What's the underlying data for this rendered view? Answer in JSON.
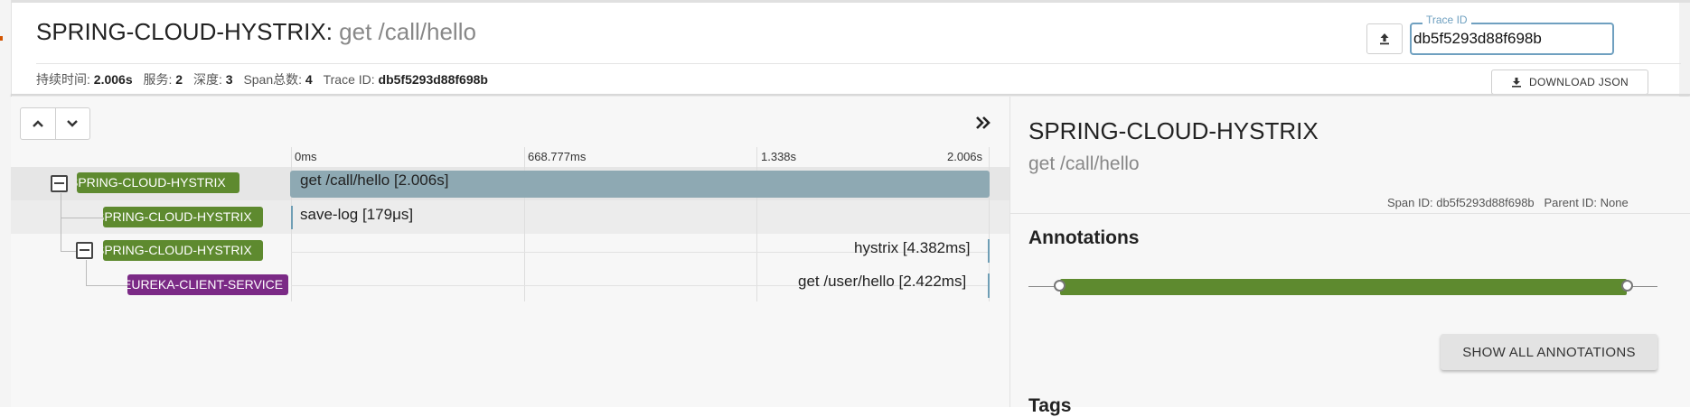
{
  "header": {
    "service": "SPRING-CLOUD-HYSTRIX",
    "separator": ":",
    "operation": "get /call/hello",
    "trace_id_label": "Trace ID",
    "trace_id_value": "db5f5293d88f698b",
    "download_label": "DOWNLOAD JSON",
    "meta": {
      "duration_label": "持续时间:",
      "duration_value": "2.006s",
      "services_label": "服务:",
      "services_value": "2",
      "depth_label": "深度:",
      "depth_value": "3",
      "span_total_label": "Span总数:",
      "span_total_value": "4",
      "trace_label": "Trace ID:",
      "trace_value": "db5f5293d88f698b"
    }
  },
  "timeline": {
    "ticks": [
      "0ms",
      "668.777ms",
      "1.338s",
      "2.006s"
    ],
    "rows": [
      {
        "service": "SPRING-CLOUD-HYSTRIX",
        "label": "get /call/hello [2.006s]",
        "color": "#5e8a2f"
      },
      {
        "service": "SPRING-CLOUD-HYSTRIX",
        "label": "save-log [179μs]",
        "color": "#5e8a2f"
      },
      {
        "service": "SPRING-CLOUD-HYSTRIX",
        "label": "hystrix [4.382ms]",
        "color": "#5e8a2f"
      },
      {
        "service": "EUREKA-CLIENT-SERVICE",
        "label": "get /user/hello [2.422ms]",
        "color": "#7b2a86"
      }
    ]
  },
  "detail": {
    "service": "SPRING-CLOUD-HYSTRIX",
    "operation": "get /call/hello",
    "span_id_label": "Span ID:",
    "span_id": "db5f5293d88f698b",
    "parent_id_label": "Parent ID:",
    "parent_id": "None",
    "annotations_title": "Annotations",
    "show_all_label": "SHOW ALL ANNOTATIONS",
    "tags_title": "Tags"
  },
  "colors": {
    "accent": "#6fa0c0",
    "span_bar": "#8ea9b3",
    "service_green": "#5e8a2f",
    "service_purple": "#7b2a86"
  },
  "icons": {
    "upload": "upload-icon",
    "download": "download-icon",
    "up": "chevron-up-icon",
    "down": "chevron-down-icon",
    "collapse": "double-chevron-right-icon"
  }
}
